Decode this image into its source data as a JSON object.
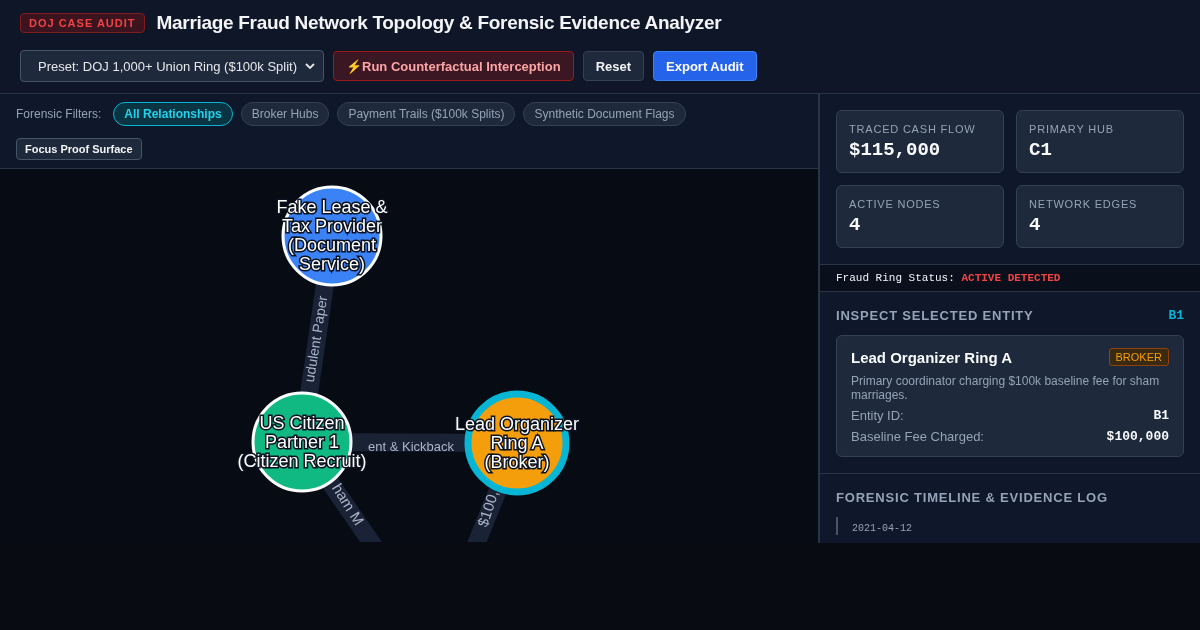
{
  "header": {
    "badge": "DOJ CASE AUDIT",
    "title": "Marriage Fraud Network Topology & Forensic Evidence Analyzer"
  },
  "toolbar": {
    "preset": "Preset: DOJ 1,000+ Union Ring ($100k Split)",
    "buttons": [
      {
        "label": "Run Counterfactual Interception",
        "icon": "⚡",
        "kind": "danger"
      },
      {
        "label": "Reset",
        "kind": "plain"
      },
      {
        "label": "Export Audit",
        "kind": "primary"
      }
    ]
  },
  "filters": {
    "label": "Forensic Filters:",
    "items": [
      {
        "label": "All Relationships",
        "selected": true
      },
      {
        "label": "Broker Hubs",
        "selected": false
      },
      {
        "label": "Payment Trails ($100k Splits)",
        "selected": false
      },
      {
        "label": "Synthetic Document Flags",
        "selected": false
      }
    ],
    "focus": "Focus Proof Surface"
  },
  "graph": {
    "nodes": [
      {
        "lines": [
          "Fake Lease &",
          "Tax Provider",
          "(Document",
          "Service)"
        ],
        "color": "#3b82f6",
        "selected": false
      },
      {
        "lines": [
          "US Citizen",
          "Partner 1",
          "(Citizen Recruit)"
        ],
        "color": "#10b981",
        "selected": false
      },
      {
        "lines": [
          "Lead Organizer",
          "Ring A",
          "(Broker)"
        ],
        "color": "#f59e0b",
        "selected": true
      }
    ],
    "edges": [
      {
        "label": "udulent Paper"
      },
      {
        "label": "ent & Kickback"
      },
      {
        "label": "ham M"
      },
      {
        "label": "$100,"
      }
    ]
  },
  "stats": [
    {
      "label": "TRACED CASH FLOW",
      "value": "$115,000"
    },
    {
      "label": "PRIMARY HUB",
      "value": "C1"
    },
    {
      "label": "ACTIVE NODES",
      "value": "4"
    },
    {
      "label": "NETWORK EDGES",
      "value": "4"
    }
  ],
  "status": {
    "label": "Fraud Ring Status:",
    "value": "ACTIVE DETECTED"
  },
  "inspect": {
    "heading": "INSPECT SELECTED ENTITY",
    "id": "B1",
    "name": "Lead Organizer Ring A",
    "role": "BROKER",
    "description": "Primary coordinator charging $100k baseline fee for sham marriages.",
    "fields": [
      {
        "label": "Entity ID:",
        "value": "B1"
      },
      {
        "label": "Baseline Fee Charged:",
        "value": "$100,000"
      }
    ]
  },
  "timeline": {
    "heading": "FORENSIC TIMELINE & EVIDENCE LOG",
    "entries": [
      {
        "date": "2021-04-12"
      }
    ]
  }
}
